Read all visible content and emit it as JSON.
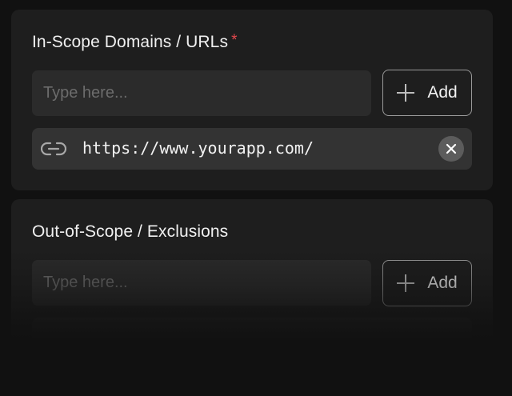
{
  "in_scope": {
    "title": "In-Scope Domains / URLs",
    "required_mark": "*",
    "input_placeholder": "Type here...",
    "add_label": "Add",
    "items": [
      {
        "url": "https://www.yourapp.com/",
        "icon": "link-icon"
      }
    ]
  },
  "out_of_scope": {
    "title": "Out-of-Scope / Exclusions",
    "input_placeholder": "Type here...",
    "add_label": "Add"
  },
  "colors": {
    "background": "#111111",
    "card": "#1e1e1e",
    "input": "#2b2b2b",
    "required": "#e5484d"
  }
}
